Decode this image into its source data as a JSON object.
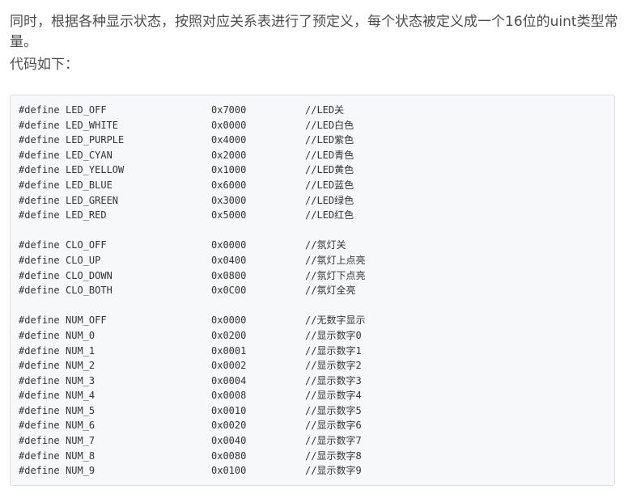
{
  "article": {
    "para1": "同时，根据各种显示状态，按照对应关系表进行了预定义，每个状态被定义成一个16位的uint类型常量。",
    "para2": "代码如下："
  },
  "code": {
    "keyword": "#define",
    "groups": [
      [
        {
          "name": "LED_OFF",
          "value": "0x7000",
          "comment": "//LED关"
        },
        {
          "name": "LED_WHITE",
          "value": "0x0000",
          "comment": "//LED白色"
        },
        {
          "name": "LED_PURPLE",
          "value": "0x4000",
          "comment": "//LED紫色"
        },
        {
          "name": "LED_CYAN",
          "value": "0x2000",
          "comment": "//LED青色"
        },
        {
          "name": "LED_YELLOW",
          "value": "0x1000",
          "comment": "//LED黄色"
        },
        {
          "name": "LED_BLUE",
          "value": "0x6000",
          "comment": "//LED蓝色"
        },
        {
          "name": "LED_GREEN",
          "value": "0x3000",
          "comment": "//LED绿色"
        },
        {
          "name": "LED_RED",
          "value": "0x5000",
          "comment": "//LED红色"
        }
      ],
      [
        {
          "name": "CLO_OFF",
          "value": "0x0000",
          "comment": "//氛灯关"
        },
        {
          "name": "CLO_UP",
          "value": "0x0400",
          "comment": "//氛灯上点亮"
        },
        {
          "name": "CLO_DOWN",
          "value": "0x0800",
          "comment": "//氛灯下点亮"
        },
        {
          "name": "CLO_BOTH",
          "value": "0x0C00",
          "comment": "//氛灯全亮"
        }
      ],
      [
        {
          "name": "NUM_OFF",
          "value": "0x0000",
          "comment": "//无数字显示"
        },
        {
          "name": "NUM_0",
          "value": "0x0200",
          "comment": "//显示数字0"
        },
        {
          "name": "NUM_1",
          "value": "0x0001",
          "comment": "//显示数字1"
        },
        {
          "name": "NUM_2",
          "value": "0x0002",
          "comment": "//显示数字2"
        },
        {
          "name": "NUM_3",
          "value": "0x0004",
          "comment": "//显示数字3"
        },
        {
          "name": "NUM_4",
          "value": "0x0008",
          "comment": "//显示数字4"
        },
        {
          "name": "NUM_5",
          "value": "0x0010",
          "comment": "//显示数字5"
        },
        {
          "name": "NUM_6",
          "value": "0x0020",
          "comment": "//显示数字6"
        },
        {
          "name": "NUM_7",
          "value": "0x0040",
          "comment": "//显示数字7"
        },
        {
          "name": "NUM_8",
          "value": "0x0080",
          "comment": "//显示数字8"
        },
        {
          "name": "NUM_9",
          "value": "0x0100",
          "comment": "//显示数字9"
        }
      ]
    ]
  }
}
